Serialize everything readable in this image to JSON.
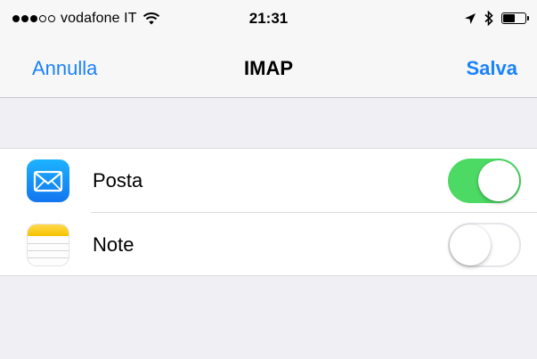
{
  "status_bar": {
    "carrier": "vodafone IT",
    "signal_bars_filled": 3,
    "signal_bars_total": 5,
    "time": "21:31",
    "battery_level": 0.55,
    "icons": [
      "wifi-icon",
      "location-arrow-icon",
      "bluetooth-icon",
      "battery-icon"
    ]
  },
  "nav": {
    "left_label": "Annulla",
    "title": "IMAP",
    "right_label": "Salva",
    "accent_color": "#1a82fb"
  },
  "items": [
    {
      "label": "Posta",
      "icon": "mail-icon",
      "enabled": true
    },
    {
      "label": "Note",
      "icon": "notes-icon",
      "enabled": false
    }
  ],
  "colors": {
    "toggle_on": "#4cd964",
    "background": "#efeff4"
  }
}
